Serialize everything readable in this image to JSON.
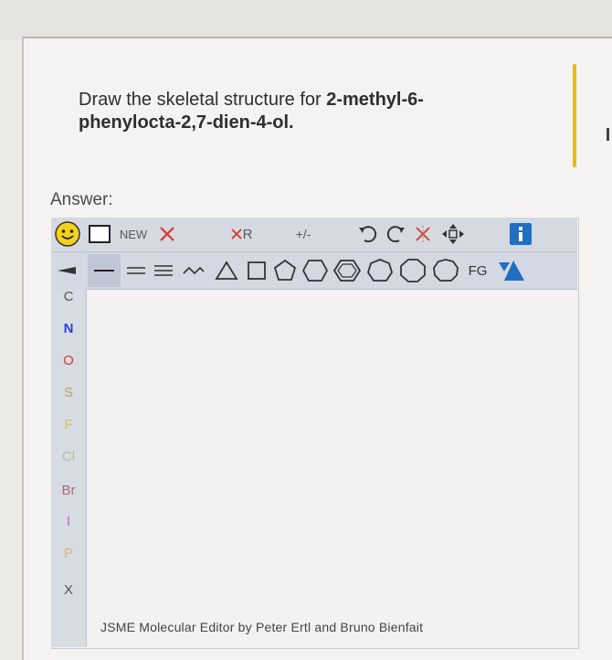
{
  "question": {
    "prefix": "Draw the skeletal structure for ",
    "compound_line1": "2-methyl-6-",
    "compound_line2": "phenylocta-2,7-dien-4-ol."
  },
  "answer": {
    "label": "Answer:"
  },
  "editor": {
    "toolbar1": {
      "new_label": "NEW",
      "r_group_label": "R",
      "charge_label": "+/-"
    },
    "toolbar2": {
      "fg_label": "FG"
    },
    "elements": [
      "C",
      "N",
      "O",
      "S",
      "F",
      "Cl",
      "Br",
      "I",
      "P",
      "X"
    ],
    "element_colors": {
      "C": "#555555",
      "N": "#2f3fd6",
      "O": "#d93a2b",
      "S": "#c8a24a",
      "F": "#d6c15a",
      "Cl": "#a6c99c",
      "Br": "#b06a6a",
      "I": "#b56ad6",
      "P": "#d8b27a",
      "X": "#555555"
    },
    "icons": {
      "smiley": "smiley-icon",
      "select": "select-rectangle-icon",
      "delete": "delete-x-icon",
      "undo": "undo-icon",
      "redo": "redo-icon",
      "info": "info-icon",
      "query": "query-triangle-icon"
    },
    "footer": "JSME Molecular Editor by Peter Ertl and Bruno Bienfait"
  },
  "colors": {
    "accent": "#e8b81c",
    "info_blue": "#1f6fc2",
    "red": "#d63a2c",
    "toolbar": "#d5d9e2"
  }
}
